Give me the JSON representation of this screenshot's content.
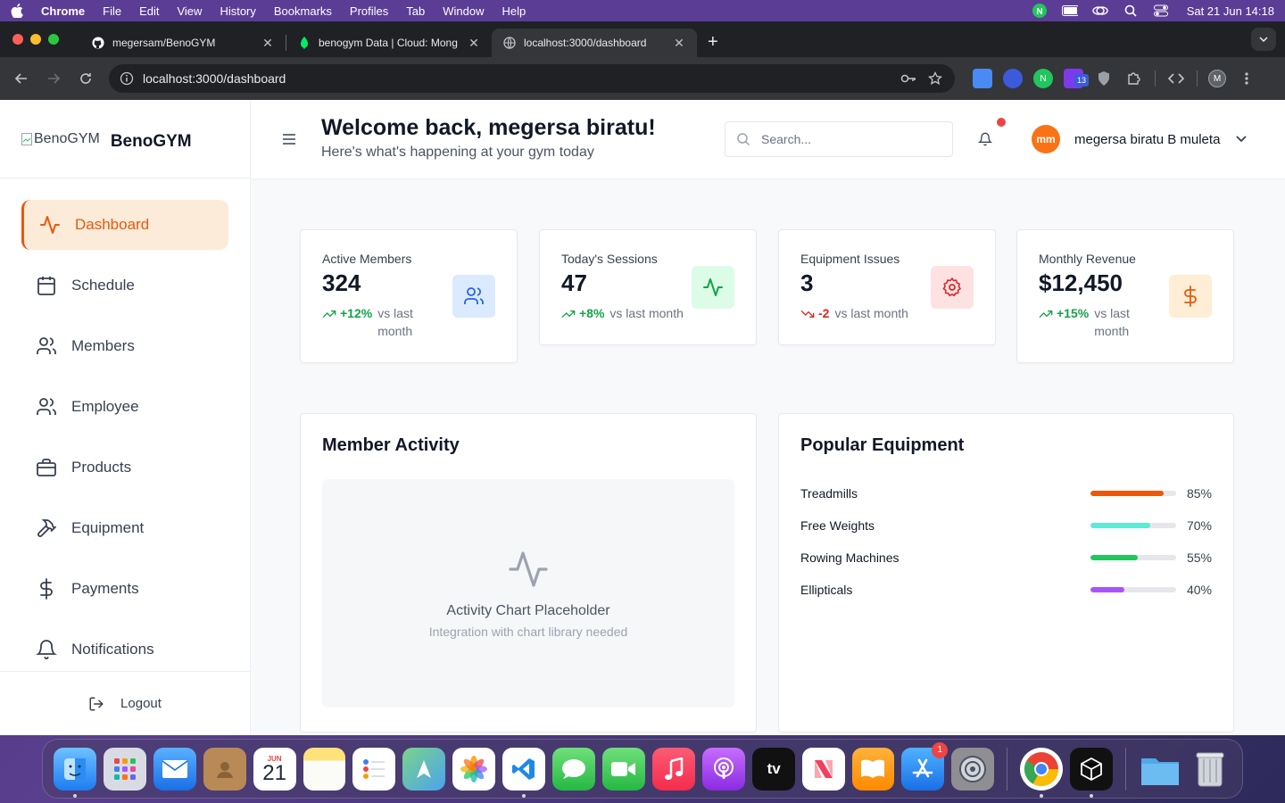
{
  "menubar": {
    "app_name": "Chrome",
    "items": [
      "File",
      "Edit",
      "View",
      "History",
      "Bookmarks",
      "Profiles",
      "Tab",
      "Window",
      "Help"
    ],
    "clock": "Sat 21 Jun  14:18"
  },
  "browser": {
    "tabs": [
      {
        "title": "megersam/BenoGYM",
        "favicon": "github-icon"
      },
      {
        "title": "benogym Data | Cloud: Mong",
        "favicon": "mongodb-leaf-icon"
      },
      {
        "title": "localhost:3000/dashboard",
        "favicon": "globe-icon"
      }
    ],
    "url": "localhost:3000/dashboard",
    "extension_badge": "13",
    "profile_initial": "M"
  },
  "sidebar": {
    "brand_logo_alt": "BenoGYM",
    "brand_name": "BenoGYM",
    "items": [
      {
        "label": "Dashboard",
        "icon": "activity-icon",
        "active": true
      },
      {
        "label": "Schedule",
        "icon": "calendar-icon"
      },
      {
        "label": "Members",
        "icon": "users-icon"
      },
      {
        "label": "Employee",
        "icon": "users-icon"
      },
      {
        "label": "Products",
        "icon": "briefcase-icon"
      },
      {
        "label": "Equipment",
        "icon": "hammer-icon"
      },
      {
        "label": "Payments",
        "icon": "dollar-icon"
      },
      {
        "label": "Notifications",
        "icon": "bell-icon"
      }
    ],
    "logout_label": "Logout"
  },
  "header": {
    "title": "Welcome back, megersa biratu!",
    "subtitle": "Here's what's happening at your gym today",
    "search_placeholder": "Search...",
    "user_initials": "mm",
    "user_name": "megersa biratu B muleta"
  },
  "stats": [
    {
      "label": "Active Members",
      "value": "324",
      "delta": "+12%",
      "direction": "up",
      "suffix": "vs last month",
      "icon": "users-icon",
      "icon_bg": "#dbeafe",
      "icon_color": "#2563eb"
    },
    {
      "label": "Today's Sessions",
      "value": "47",
      "delta": "+8%",
      "direction": "up",
      "suffix": "vs last month",
      "icon": "activity-icon",
      "icon_bg": "#dcfce7",
      "icon_color": "#16a34a"
    },
    {
      "label": "Equipment Issues",
      "value": "3",
      "delta": "-2",
      "direction": "down",
      "suffix": "vs last month",
      "icon": "gear-icon",
      "icon_bg": "#fee2e2",
      "icon_color": "#dc2626"
    },
    {
      "label": "Monthly Revenue",
      "value": "$12,450",
      "delta": "+15%",
      "direction": "up",
      "suffix": "vs last month",
      "icon": "dollar-icon",
      "icon_bg": "#ffedd5",
      "icon_color": "#ea580c"
    }
  ],
  "member_activity": {
    "title": "Member Activity",
    "placeholder_title": "Activity Chart Placeholder",
    "placeholder_subtitle": "Integration with chart library needed"
  },
  "popular_equipment": {
    "title": "Popular Equipment",
    "items": [
      {
        "name": "Treadmills",
        "percent": 85,
        "label": "85%",
        "color": "#ea580c"
      },
      {
        "name": "Free Weights",
        "percent": 70,
        "label": "70%",
        "color": "#5eead4"
      },
      {
        "name": "Rowing Machines",
        "percent": 55,
        "label": "55%",
        "color": "#22c55e"
      },
      {
        "name": "Ellipticals",
        "percent": 40,
        "label": "40%",
        "color": "#a855f7"
      }
    ]
  },
  "dock": {
    "calendar_month": "JUN",
    "calendar_day": "21",
    "tv_label": "tv",
    "appstore_badge": "1"
  },
  "colors": {
    "accent": "#ea580c",
    "accent_bg": "#fdebd9"
  }
}
